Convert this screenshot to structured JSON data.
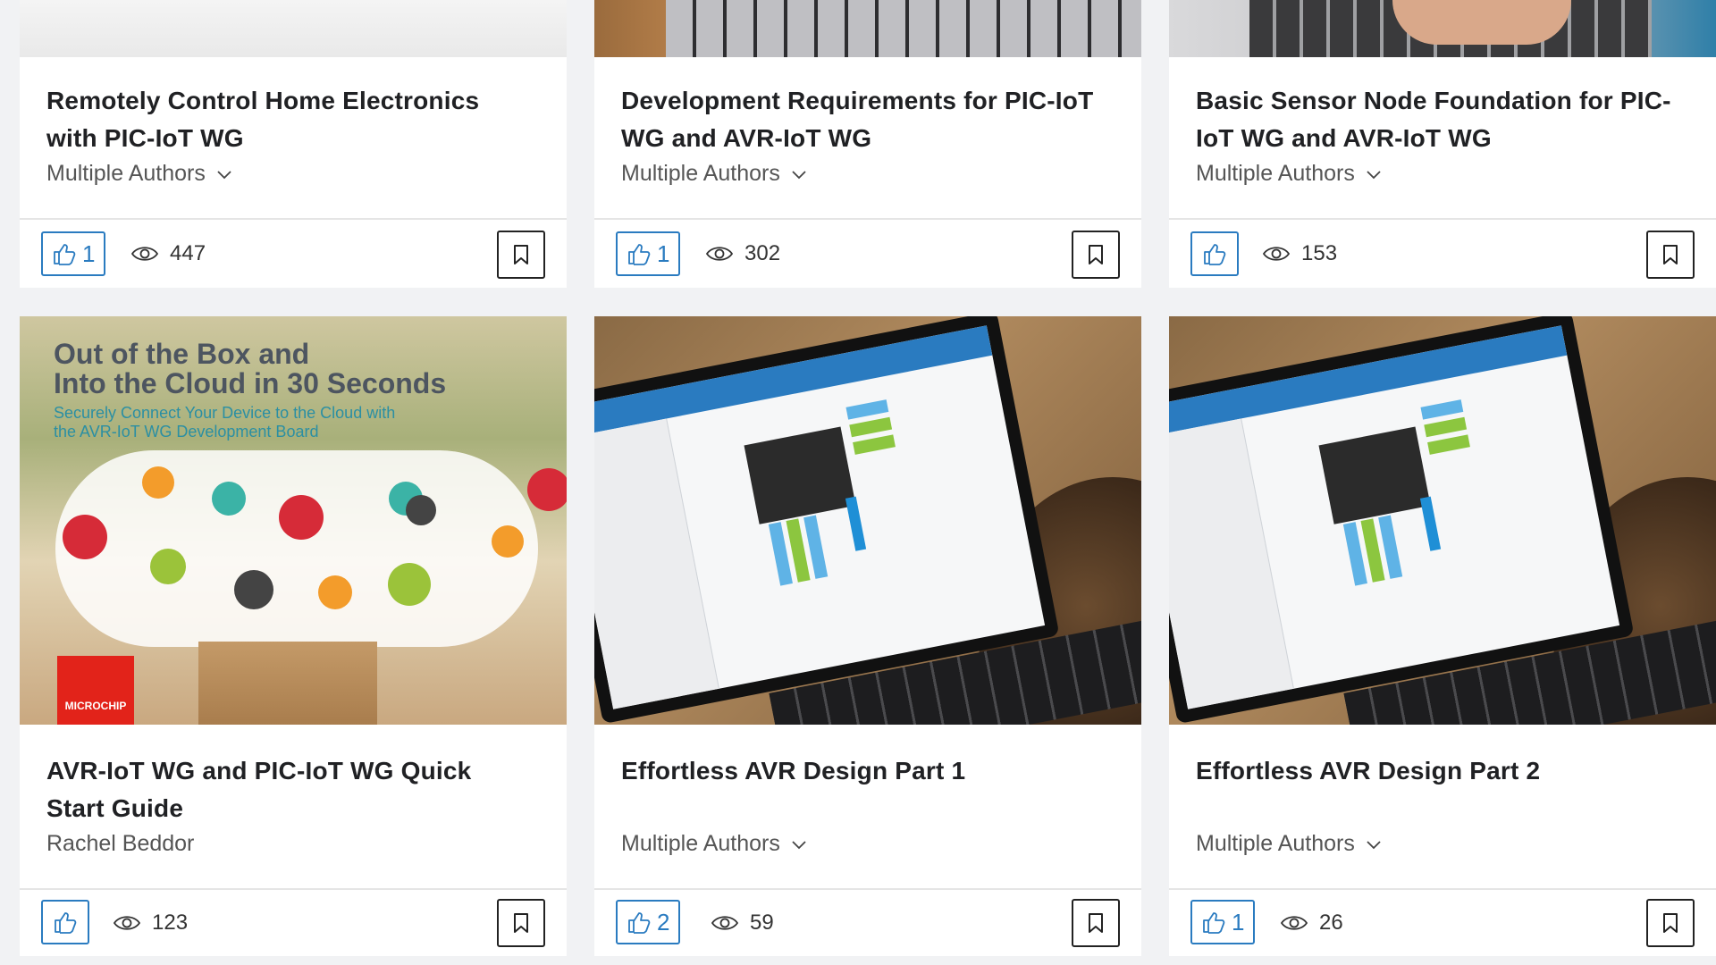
{
  "colors": {
    "accent": "#2a7bc0",
    "card_bg": "#ffffff",
    "page_bg": "#f1f2f4",
    "brand_red": "#e2231a"
  },
  "cards": [
    {
      "title_line1": "Remotely Control Home Electronics",
      "title_line2": "with PIC-IoT WG",
      "author": "Multiple Authors",
      "author_dropdown": true,
      "likes": "1",
      "views": "447"
    },
    {
      "title_line1": "Development Requirements for PIC-IoT",
      "title_line2": "WG and AVR-IoT WG",
      "author": "Multiple Authors",
      "author_dropdown": true,
      "likes": "1",
      "views": "302"
    },
    {
      "title_line1": "Basic Sensor Node Foundation for PIC-",
      "title_line2": "IoT WG and AVR-IoT WG",
      "author": "Multiple Authors",
      "author_dropdown": true,
      "likes": "",
      "views": "153"
    },
    {
      "title_line1": "AVR-IoT WG and PIC-IoT WG Quick",
      "title_line2": "Start Guide",
      "author": "Rachel Beddor",
      "author_dropdown": false,
      "likes": "",
      "views": "123",
      "thumb": {
        "headline_1": "Out of the Box and",
        "headline_2": "Into the Cloud in 30 Seconds",
        "sub_1": "Securely Connect Your Device to the Cloud with",
        "sub_2": "the AVR-IoT WG Development Board",
        "logo": "MICROCHIP"
      }
    },
    {
      "title_line1": "Effortless AVR Design Part 1",
      "title_line2": "",
      "author": "Multiple Authors",
      "author_dropdown": true,
      "likes": "2",
      "views": "59"
    },
    {
      "title_line1": "Effortless AVR Design Part 2",
      "title_line2": "",
      "author": "Multiple Authors",
      "author_dropdown": true,
      "likes": "1",
      "views": "26"
    }
  ],
  "icons": {
    "like": "thumbs-up-icon",
    "views": "eye-icon",
    "bookmark": "bookmark-icon",
    "dropdown": "chevron-down-icon"
  }
}
